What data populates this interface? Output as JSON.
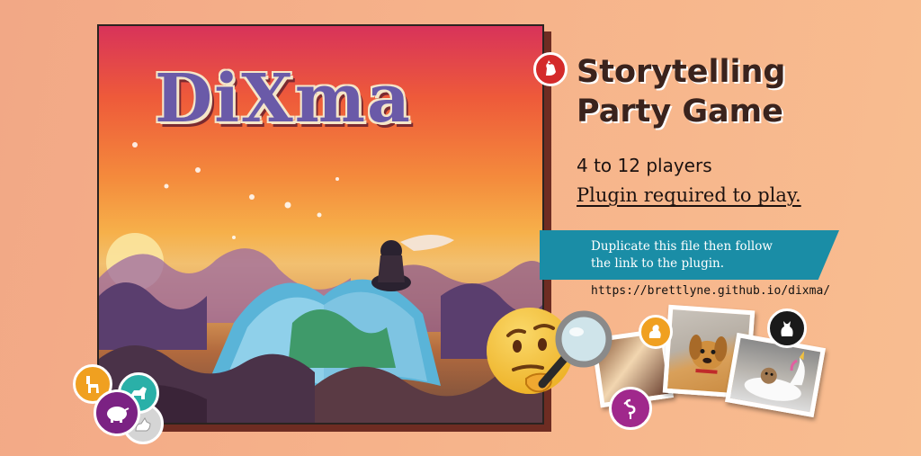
{
  "box_art": {
    "title": "DiXma"
  },
  "headline": {
    "line1": "Storytelling",
    "line2": "Party Game"
  },
  "players": "4 to 12 players",
  "plugin_required": "Plugin required to play.",
  "banner": {
    "line1": "Duplicate this file then follow",
    "line2": "the link to the plugin."
  },
  "plugin_link": "https://brettlyne.github.io/dixma/",
  "icons": {
    "rooster": "rooster-icon",
    "llama": "llama-icon",
    "pig": "pig-icon",
    "goat": "goat-icon",
    "cat": "cat-icon",
    "squirrel": "squirrel-icon",
    "flamingo": "flamingo-icon",
    "emoji": "thinking-face-icon",
    "magnifier": "magnifying-glass-icon"
  },
  "colors": {
    "banner": "#1a8da6",
    "headline": "#3a231d",
    "badge_red": "#d42a2a",
    "badge_orange": "#f0a020",
    "badge_purple": "#7b2283",
    "badge_teal": "#2ab0a8",
    "badge_black": "#1a1a1a",
    "badge_magenta": "#a0288c"
  }
}
